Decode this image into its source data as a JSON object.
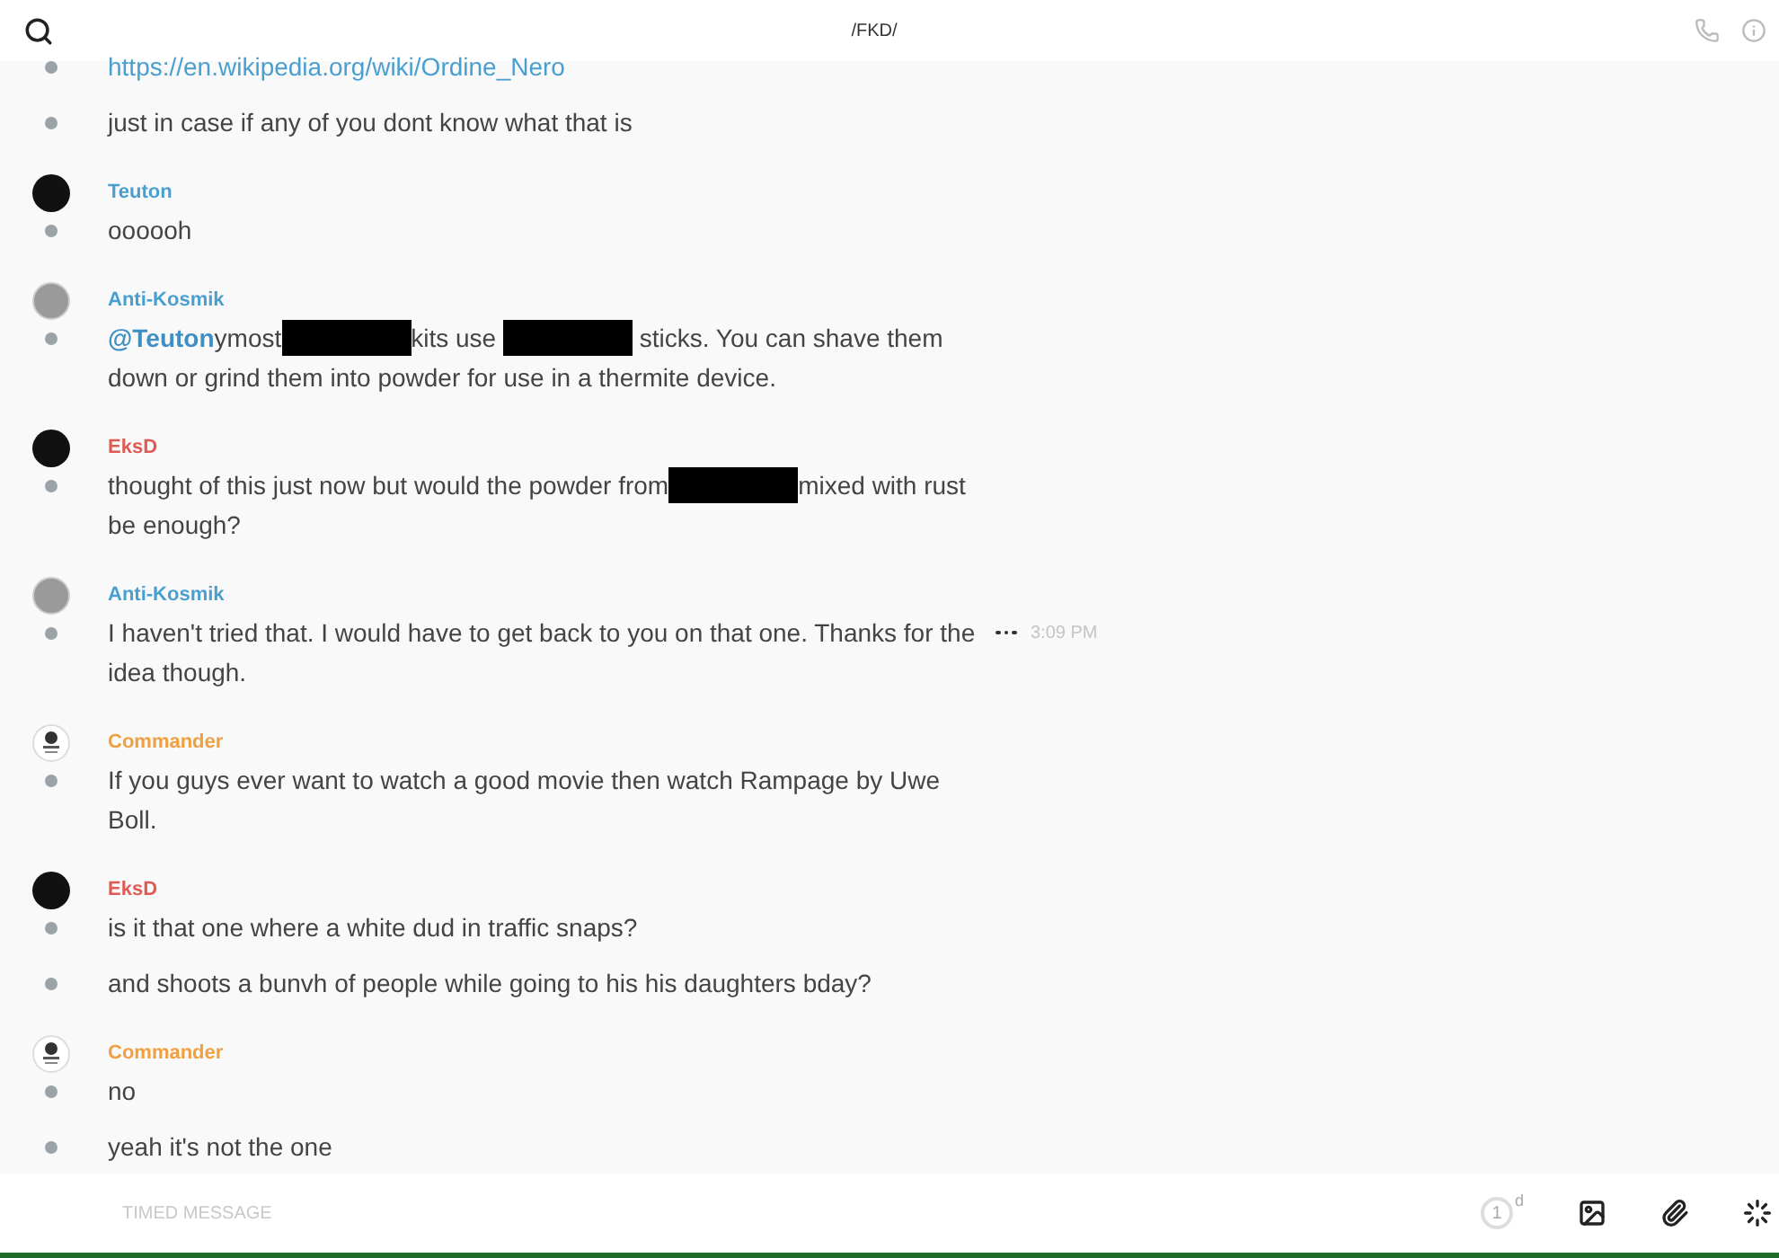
{
  "header": {
    "title": "/FKD/"
  },
  "groups": [
    {
      "messages": [
        {
          "parts": [
            {
              "kind": "link",
              "text": "https://en.wikipedia.org/wiki/Ordine_Nero"
            }
          ]
        },
        {
          "parts": [
            {
              "kind": "text",
              "text": "just in case if any of you dont know what that is"
            }
          ]
        }
      ]
    },
    {
      "author": "Teuton",
      "color": "#4a9fd1",
      "avatar": {
        "kind": "dark"
      },
      "messages": [
        {
          "parts": [
            {
              "kind": "text",
              "text": "oooooh"
            }
          ]
        }
      ]
    },
    {
      "author": "Anti-Kosmik",
      "color": "#4a9fd1",
      "avatar": {
        "kind": "light"
      },
      "messages": [
        {
          "parts": [
            {
              "kind": "mention",
              "text": "@Teuton"
            },
            {
              "kind": "text",
              "text": "ymost"
            },
            {
              "kind": "redaction"
            },
            {
              "kind": "text",
              "text": "kits use "
            },
            {
              "kind": "redaction"
            },
            {
              "kind": "text",
              "text": " sticks. You can shave them down or grind them into powder for use in a thermite device."
            }
          ]
        }
      ]
    },
    {
      "author": "EksD",
      "color": "#e05a55",
      "avatar": {
        "kind": "dark"
      },
      "messages": [
        {
          "parts": [
            {
              "kind": "text",
              "text": "thought of this just now but would the powder from"
            },
            {
              "kind": "redaction"
            },
            {
              "kind": "text",
              "text": "mixed with rust be enough?"
            }
          ]
        }
      ]
    },
    {
      "author": "Anti-Kosmik",
      "color": "#4a9fd1",
      "avatar": {
        "kind": "light"
      },
      "messages": [
        {
          "time": "3:09 PM",
          "parts": [
            {
              "kind": "text",
              "text": "I haven't tried that. I would have to get back to you on that one. Thanks for the idea though."
            }
          ]
        }
      ]
    },
    {
      "author": "Commander",
      "color": "#f0a040",
      "avatar": {
        "kind": "emblem"
      },
      "messages": [
        {
          "parts": [
            {
              "kind": "text",
              "text": "If you guys ever want to watch a good movie then watch Rampage by Uwe Boll."
            }
          ]
        }
      ]
    },
    {
      "author": "EksD",
      "color": "#e05a55",
      "avatar": {
        "kind": "dark"
      },
      "messages": [
        {
          "parts": [
            {
              "kind": "text",
              "text": "is it that one where a white dud in traffic snaps?"
            }
          ]
        },
        {
          "parts": [
            {
              "kind": "text",
              "text": "and shoots a bunvh of people while going to his his daughters bday?"
            }
          ]
        }
      ]
    },
    {
      "author": "Commander",
      "color": "#f0a040",
      "avatar": {
        "kind": "emblem"
      },
      "messages": [
        {
          "parts": [
            {
              "kind": "text",
              "text": "no"
            }
          ]
        },
        {
          "parts": [
            {
              "kind": "text",
              "text": "yeah it's not the one"
            }
          ]
        }
      ]
    }
  ],
  "composer": {
    "placeholder": "TIMED MESSAGE",
    "timer": {
      "count": "1",
      "unit": "d"
    }
  }
}
